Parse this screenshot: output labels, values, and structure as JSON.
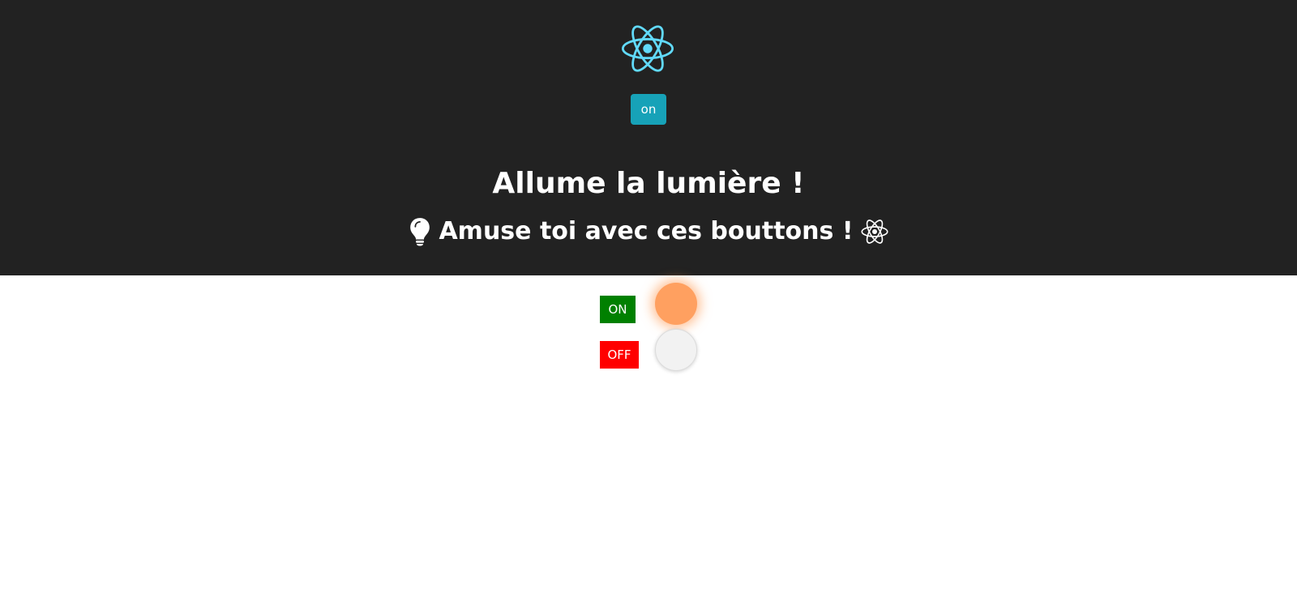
{
  "header": {
    "logo_icon": "react-atom-icon",
    "logo_color": "#61dafb",
    "toggle_button_label": "on",
    "toggle_button_color": "#17a2b8",
    "title": "Allume la lumière !",
    "subtitle": "Amuse toi avec ces bouttons !",
    "subtitle_left_icon": "lightbulb-icon",
    "subtitle_right_icon": "react-atom-icon",
    "background": "#222222"
  },
  "controls": {
    "on_button": {
      "label": "ON",
      "color": "#008000"
    },
    "off_button": {
      "label": "OFF",
      "color": "#ff0000"
    },
    "lights": [
      {
        "state": "on",
        "color": "#ffa060"
      },
      {
        "state": "off",
        "color": "#f2f2f2"
      }
    ]
  }
}
